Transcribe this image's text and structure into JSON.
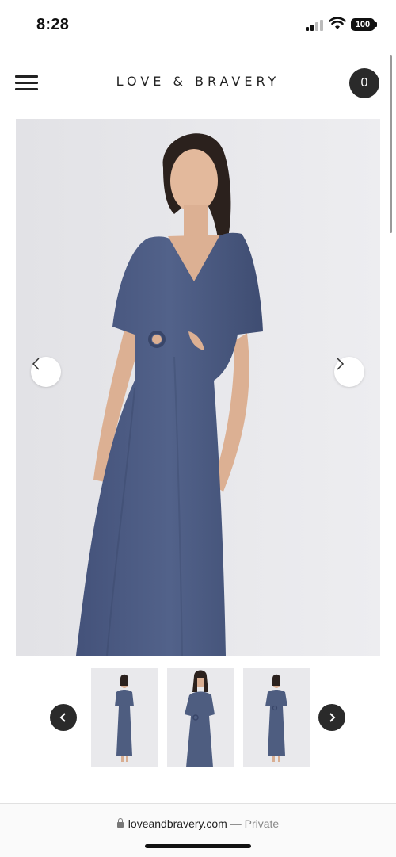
{
  "status_bar": {
    "time": "8:28",
    "battery": "100"
  },
  "header": {
    "brand": "LOVE & BRAVERY",
    "cart_count": "0",
    "menu_icon": "hamburger-menu-icon"
  },
  "gallery": {
    "prev_icon": "chevron-left-icon",
    "next_icon": "chevron-right-icon",
    "thumbnail_count": 3
  },
  "browser": {
    "domain": "loveandbravery.com",
    "separator": "—",
    "privacy": "Private"
  },
  "colors": {
    "dress": "#4e5d80",
    "background": "#e7e7ea",
    "dark_button": "#2a2a2a"
  }
}
